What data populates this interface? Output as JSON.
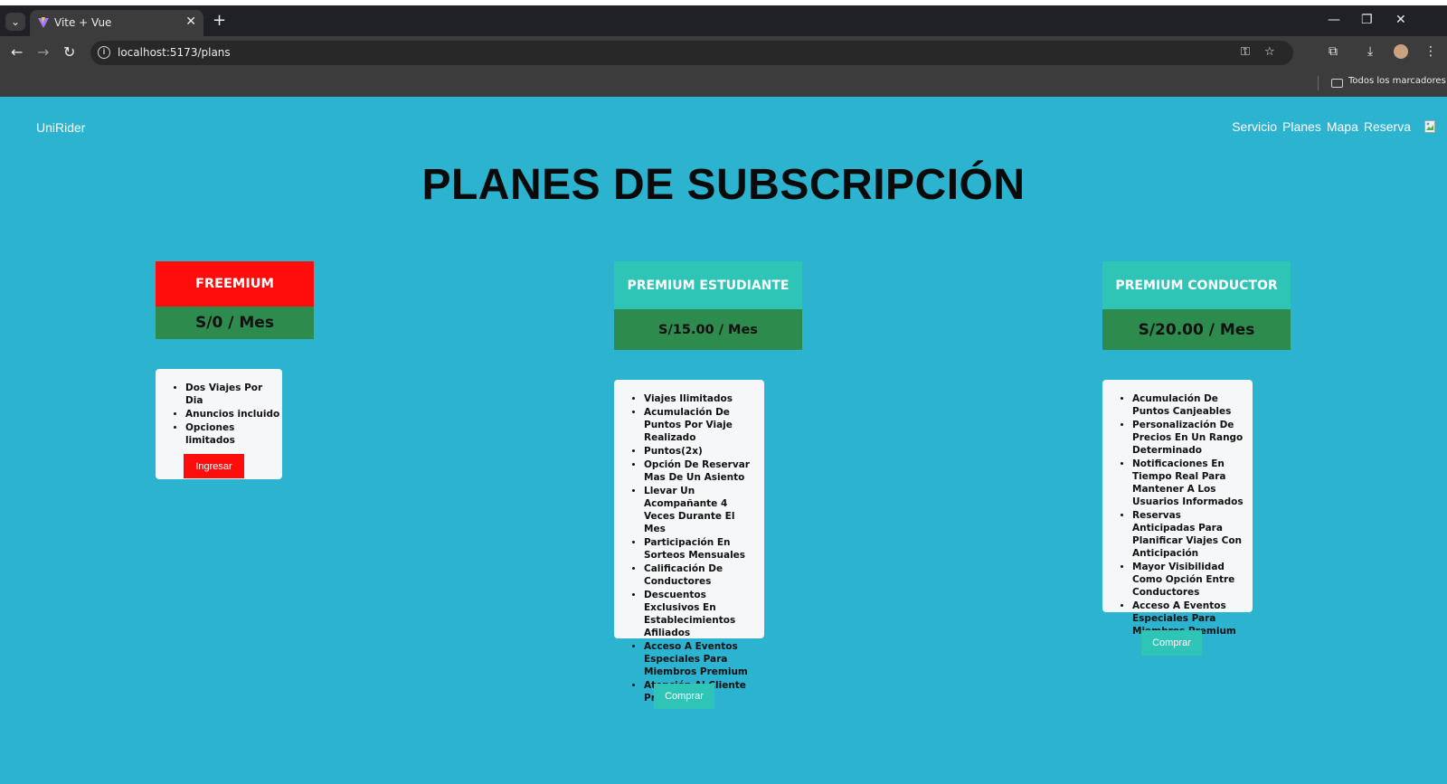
{
  "browser": {
    "tab_title": "Vite + Vue",
    "tab_close": "✕",
    "new_tab": "+",
    "url": "localhost:5173/plans",
    "bookmarks_label": "Todos los marcadores"
  },
  "nav": {
    "brand": "UniRider",
    "links": [
      "Servicio",
      "Planes",
      "Mapa",
      "Reserva"
    ]
  },
  "page_title": "PLANES DE SUBSCRIPCIÓN",
  "plans": [
    {
      "name": "FREEMIUM",
      "price": "S/0 / Mes",
      "header_color": "#ff0d0d",
      "features": [
        "Dos Viajes Por Dia",
        "Anuncios incluido",
        "Opciones limitados"
      ],
      "button": "Ingresar",
      "button_color": "#ff0d0d"
    },
    {
      "name": "PREMIUM ESTUDIANTE",
      "price": "S/15.00 / Mes",
      "header_color": "#2ec4b6",
      "features": [
        "Viajes Ilimitados",
        "Acumulación De Puntos Por Viaje Realizado",
        "Puntos(2x)",
        "Opción De Reservar Mas De Un Asiento",
        "Llevar Un Acompañante 4 Veces Durante El Mes",
        "Participación En Sorteos Mensuales",
        "Calificación De Conductores",
        "Descuentos Exclusivos En Establecimientos Afiliados",
        "Acceso A Eventos Especiales Para Miembros Premium",
        "Atención Al Cliente Prioritaria"
      ],
      "button": "Comprar",
      "button_color": "#2ec4b6"
    },
    {
      "name": "PREMIUM CONDUCTOR",
      "price": "S/20.00 / Mes",
      "header_color": "#2ec4b6",
      "features": [
        "Acumulación De Puntos Canjeables",
        "Personalización De Precios En Un Rango Determinado",
        "Notificaciones En Tiempo Real Para Mantener A Los Usuarios Informados",
        "Reservas Anticipadas Para Planificar Viajes Con Anticipación",
        "Mayor Visibilidad Como Opción Entre Conductores",
        "Acceso A Eventos Especiales Para Miembros Premium"
      ],
      "button": "Comprar",
      "button_color": "#2ec4b6"
    }
  ],
  "colors": {
    "page_bg": "#2bb3cf",
    "price_bg": "#2e8b4e"
  }
}
